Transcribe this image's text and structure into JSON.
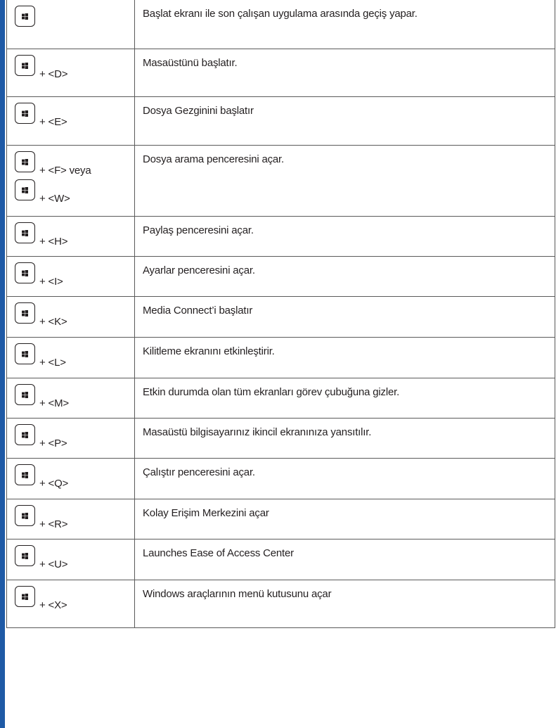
{
  "rows": [
    {
      "keys": [
        ""
      ],
      "desc": "Başlat ekranı ile son çalışan uygulama arasında geçiş yapar."
    },
    {
      "keys": [
        "+ <D>"
      ],
      "desc": "Masaüstünü başlatır."
    },
    {
      "keys": [
        "+ <E>"
      ],
      "desc": "Dosya Gezginini başlatır"
    },
    {
      "keys": [
        "+ <F>  veya",
        "+ <W>"
      ],
      "desc": "Dosya arama penceresini açar."
    },
    {
      "keys": [
        "+ <H>"
      ],
      "desc": "Paylaş penceresini açar."
    },
    {
      "keys": [
        "+ <I>"
      ],
      "desc": "Ayarlar penceresini açar."
    },
    {
      "keys": [
        "+ <K>"
      ],
      "desc": "Media Connect’i başlatır"
    },
    {
      "keys": [
        "+ <L>"
      ],
      "desc": "Kilitleme ekranını etkinleştirir."
    },
    {
      "keys": [
        "+ <M>"
      ],
      "desc": "Etkin durumda olan tüm ekranları görev çubuğuna gizler."
    },
    {
      "keys": [
        "+ <P>"
      ],
      "desc": "Masaüstü bilgisayarınız ikincil ekranınıza yansıtılır."
    },
    {
      "keys": [
        "+ <Q>"
      ],
      "desc": "Çalıştır penceresini açar."
    },
    {
      "keys": [
        "+ <R>"
      ],
      "desc": "Kolay Erişim Merkezini açar"
    },
    {
      "keys": [
        "+ <U>"
      ],
      "desc": "Launches Ease of Access Center"
    },
    {
      "keys": [
        "+ <X>"
      ],
      "desc": "Windows araçlarının menü kutusunu açar"
    }
  ],
  "accent_color": "#1f5aa6",
  "key_icon": "windows-key-icon"
}
